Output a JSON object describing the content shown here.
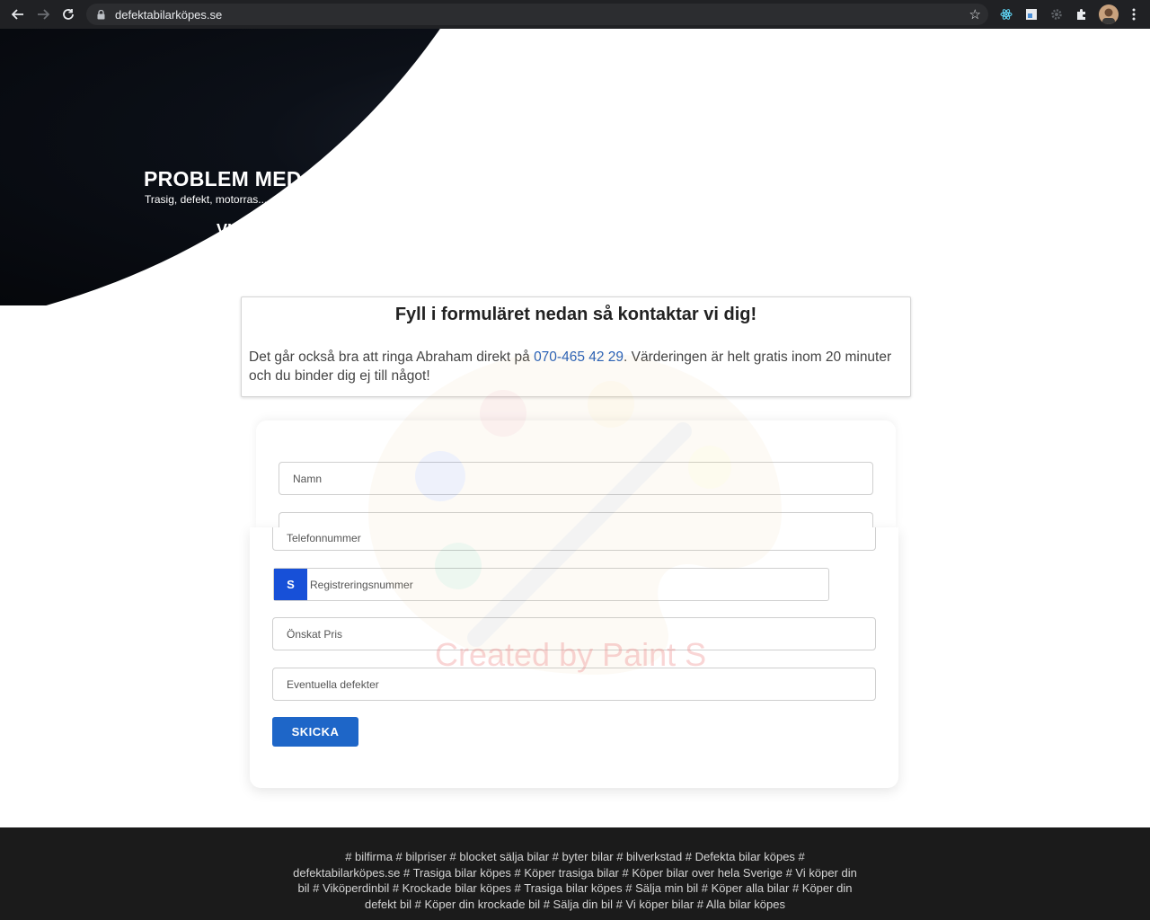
{
  "browser": {
    "url": "defektabilarköpes.se"
  },
  "hero": {
    "title": "PROBLEM MED BILEN?",
    "subtitle": "Trasig, defekt, motorras...",
    "cta": "VI KÖPER ALLT!"
  },
  "info": {
    "title": "Fyll i formuläret nedan så kontaktar vi dig!",
    "text_before": "Det går också bra att ringa Abraham direkt på ",
    "phone": "070-465 42 29",
    "text_after": ". Värderingen är helt gratis inom 20 minuter och du binder dig ej till något!"
  },
  "form": {
    "name_placeholder": "Namn",
    "phone_placeholder": "Telefonnummer",
    "reg_badge": "S",
    "reg_placeholder": "Registreringsnummer",
    "price_placeholder": "Önskat Pris",
    "defects_placeholder": "Eventuella defekter",
    "submit_label": "SKICKA"
  },
  "watermark": "Created by Paint S",
  "footer": {
    "tags": "# bilfirma # bilpriser # blocket sälja bilar # byter bilar # bilverkstad # Defekta bilar köpes # defektabilarköpes.se # Trasiga bilar köpes # Köper trasiga bilar # Köper bilar over hela Sverige # Vi köper din bil # Viköperdinbil # Krockade bilar köpes # Trasiga bilar köpes # Sälja min bil # Köper alla bilar # Köper din defekt bil # Köper din krockade bil # Sälja din bil # Vi köper bilar # Alla bilar köpes"
  }
}
